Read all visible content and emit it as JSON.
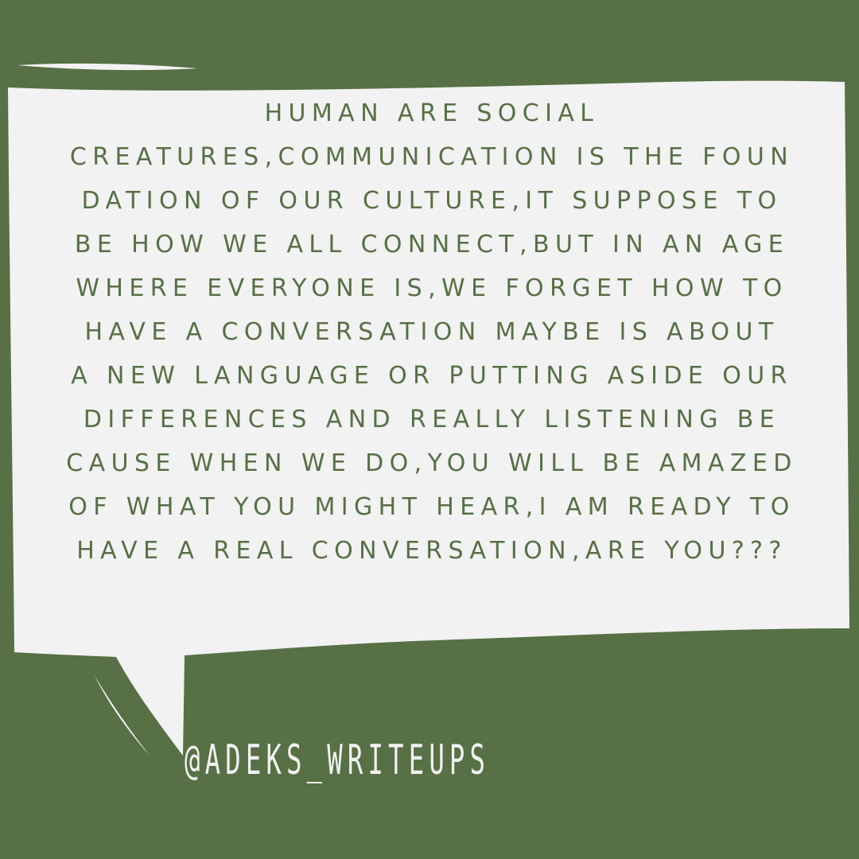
{
  "colors": {
    "background": "#577045",
    "bubble": "#f2f2f2",
    "text": "#577045",
    "handle": "#f2f2f2"
  },
  "quote": {
    "lines": [
      "HUMAN ARE SOCIAL",
      "CREATURES,COMMUNICATION IS THE FOUN",
      "DATION OF OUR CULTURE,IT SUPPOSE TO",
      "BE HOW WE ALL CONNECT,BUT IN AN AGE",
      "WHERE EVERYONE IS,WE FORGET HOW TO",
      "HAVE A CONVERSATION MAYBE IS ABOUT",
      "A NEW LANGUAGE OR PUTTING ASIDE OUR",
      "DIFFERENCES AND REALLY LISTENING BE",
      "CAUSE WHEN WE DO,YOU WILL BE AMAZED",
      "OF WHAT YOU MIGHT HEAR,I AM READY TO",
      "HAVE A REAL CONVERSATION,ARE YOU???"
    ]
  },
  "handle": "@ADEKS_WRITEUPS"
}
